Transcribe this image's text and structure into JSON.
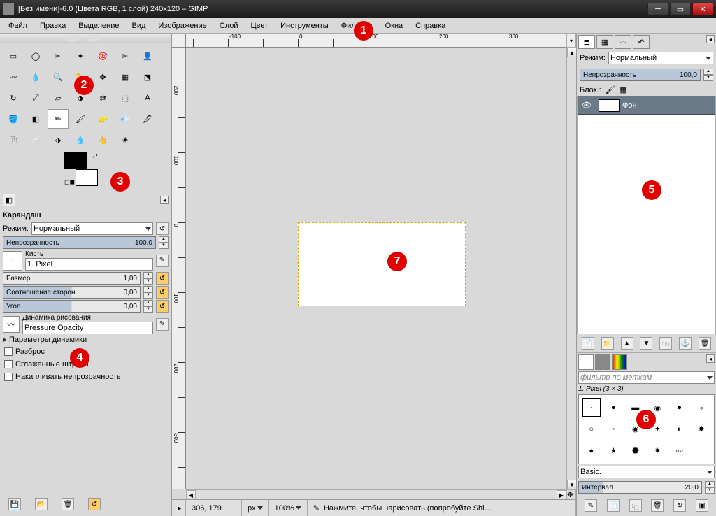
{
  "window": {
    "title": "[Без имени]-6.0 (Цвета RGB, 1 слой) 240x120 – GIMP"
  },
  "menu": [
    "Файл",
    "Правка",
    "Выделение",
    "Вид",
    "Изображение",
    "Слой",
    "Цвет",
    "Инструменты",
    "Фильтры",
    "Окна",
    "Справка"
  ],
  "tools": [
    "rect-select",
    "ellipse-select",
    "free-select",
    "fuzzy-select",
    "color-select",
    "scissors",
    "foreground-select",
    "paths",
    "color-picker",
    "zoom",
    "measure",
    "move",
    "align",
    "crop",
    "rotate",
    "scale",
    "shear",
    "perspective",
    "flip",
    "cage",
    "text",
    "bucket",
    "blend",
    "pencil",
    "paintbrush",
    "eraser",
    "airbrush",
    "ink",
    "clone",
    "heal",
    "perspective-clone",
    "blur",
    "smudge",
    "dodge",
    ""
  ],
  "active_tool_index": 23,
  "tool_options": {
    "title": "Карандаш",
    "mode_label": "Режим:",
    "mode_value": "Нормальный",
    "opacity_label": "Непрозрачность",
    "opacity_value": "100,0",
    "brush_label": "Кисть",
    "brush_value": "1. Pixel",
    "size_label": "Размер",
    "size_value": "1,00",
    "aspect_label": "Соотношение сторон",
    "aspect_value": "0,00",
    "angle_label": "Угол",
    "angle_value": "0,00",
    "dynamics_label": "Динамика рисования",
    "dynamics_value": "Pressure Opacity",
    "dyn_params": "Параметры динамики",
    "scatter": "Разброс",
    "smooth": "Сглаженные штрихи",
    "accumulate": "Накапливать непрозрачность"
  },
  "statusbar": {
    "coords": "306, 179",
    "unit": "px",
    "zoom": "100%",
    "hint": "Нажмите, чтобы нарисовать (попробуйте Shi…"
  },
  "layers": {
    "mode_label": "Режим:",
    "mode_value": "Нормальный",
    "opacity_label": "Непрозрачность",
    "opacity_value": "100,0",
    "lock_label": "Блок.:",
    "layer_name": "Фон"
  },
  "brushes": {
    "filter": "фильтр по меткам",
    "selected": "1. Pixel (3 × 3)",
    "preset": "Basic.",
    "spacing_label": "Интервал",
    "spacing_value": "20,0"
  },
  "markers": {
    "1": "1",
    "2": "2",
    "3": "3",
    "4": "4",
    "5": "5",
    "6": "6",
    "7": "7"
  }
}
